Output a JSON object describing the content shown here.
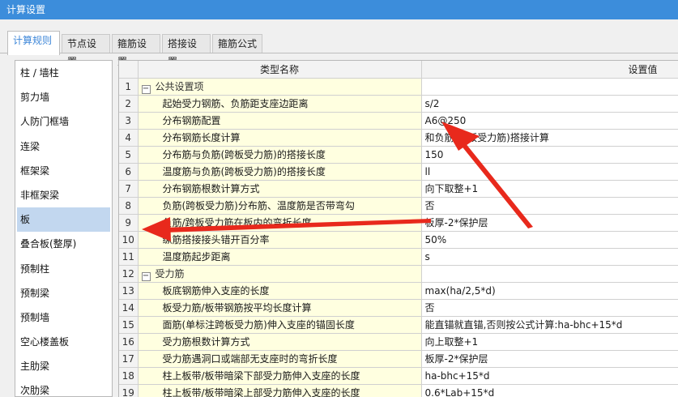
{
  "window": {
    "title": "计算设置"
  },
  "tabs": [
    {
      "label": "计算规则"
    },
    {
      "label": "节点设置"
    },
    {
      "label": "箍筋设置"
    },
    {
      "label": "搭接设置"
    },
    {
      "label": "箍筋公式"
    }
  ],
  "sidebar": {
    "items": [
      {
        "label": "柱 / 墙柱"
      },
      {
        "label": "剪力墙"
      },
      {
        "label": "人防门框墙"
      },
      {
        "label": "连梁"
      },
      {
        "label": "框架梁"
      },
      {
        "label": "非框架梁"
      },
      {
        "label": "板"
      },
      {
        "label": "叠合板(整厚)"
      },
      {
        "label": "预制柱"
      },
      {
        "label": "预制梁"
      },
      {
        "label": "预制墙"
      },
      {
        "label": "空心楼盖板"
      },
      {
        "label": "主肋梁"
      },
      {
        "label": "次肋梁"
      }
    ],
    "selected": "板"
  },
  "table": {
    "headers": {
      "name": "类型名称",
      "value": "设置值"
    },
    "rows": [
      {
        "num": "1",
        "group": true,
        "expander": "−",
        "name": "公共设置项",
        "value": ""
      },
      {
        "num": "2",
        "name": "起始受力钢筋、负筋距支座边距离",
        "value": "s/2"
      },
      {
        "num": "3",
        "name": "分布钢筋配置",
        "value": "A6@250"
      },
      {
        "num": "4",
        "name": "分布钢筋长度计算",
        "value": "和负筋(跨板受力筋)搭接计算"
      },
      {
        "num": "5",
        "name": "分布筋与负筋(跨板受力筋)的搭接长度",
        "value": "150"
      },
      {
        "num": "6",
        "name": "温度筋与负筋(跨板受力筋)的搭接长度",
        "value": "ll"
      },
      {
        "num": "7",
        "name": "分布钢筋根数计算方式",
        "value": "向下取整+1"
      },
      {
        "num": "8",
        "name": "负筋(跨板受力筋)分布筋、温度筋是否带弯勾",
        "value": "否"
      },
      {
        "num": "9",
        "name": "负筋/跨板受力筋在板内的弯折长度",
        "value": "板厚-2*保护层"
      },
      {
        "num": "10",
        "name": "纵筋搭接接头错开百分率",
        "value": "50%"
      },
      {
        "num": "11",
        "name": "温度筋起步距离",
        "value": "s"
      },
      {
        "num": "12",
        "group": true,
        "expander": "−",
        "name": "受力筋",
        "value": ""
      },
      {
        "num": "13",
        "name": "板底钢筋伸入支座的长度",
        "value": "max(ha/2,5*d)"
      },
      {
        "num": "14",
        "name": "板受力筋/板带钢筋按平均长度计算",
        "value": "否"
      },
      {
        "num": "15",
        "name": "面筋(单标注跨板受力筋)伸入支座的锚固长度",
        "value": "能直锚就直锚,否则按公式计算:ha-bhc+15*d"
      },
      {
        "num": "16",
        "name": "受力筋根数计算方式",
        "value": "向上取整+1"
      },
      {
        "num": "17",
        "name": "受力筋遇洞口或端部无支座时的弯折长度",
        "value": "板厚-2*保护层"
      },
      {
        "num": "18",
        "name": "柱上板带/板带暗梁下部受力筋伸入支座的长度",
        "value": "ha-bhc+15*d"
      },
      {
        "num": "19",
        "name": "柱上板带/板带暗梁上部受力筋伸入支座的长度",
        "value": "0.6*Lab+15*d"
      }
    ]
  },
  "annotation": {
    "arrow_color": "#e8291c"
  }
}
